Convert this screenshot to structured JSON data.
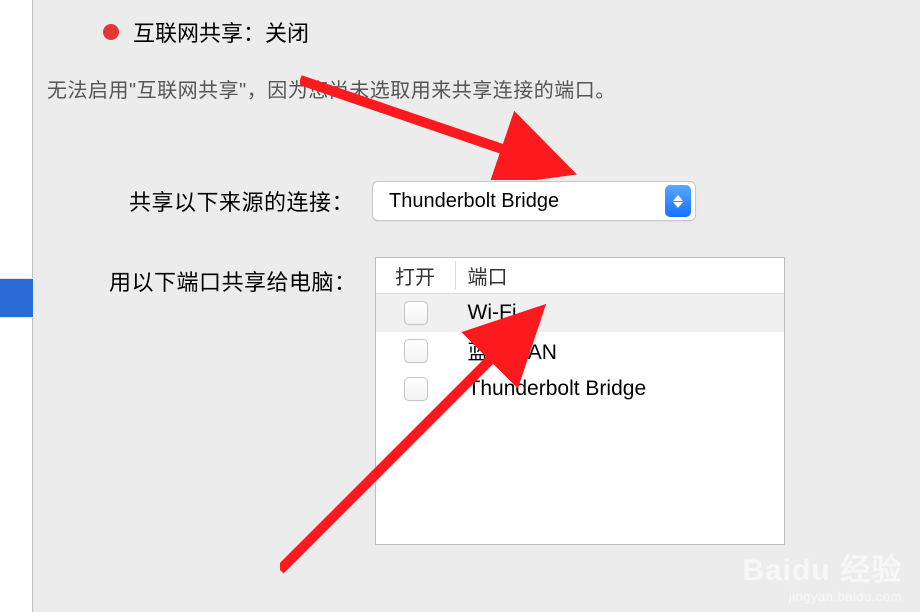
{
  "status": {
    "title": "互联网共享：关闭",
    "hint": "无法启用\"互联网共享\"，因为您尚未选取用来共享连接的端口。"
  },
  "source": {
    "label": "共享以下来源的连接：",
    "selected": "Thunderbolt Bridge"
  },
  "ports": {
    "label": "用以下端口共享给电脑：",
    "headers": {
      "open": "打开",
      "port": "端口"
    },
    "items": [
      {
        "name": "Wi-Fi",
        "checked": false,
        "selected": true
      },
      {
        "name": "蓝牙 PAN",
        "checked": false,
        "selected": false
      },
      {
        "name": "Thunderbolt Bridge",
        "checked": false,
        "selected": false
      }
    ]
  },
  "watermark": {
    "line1": "Baidu 经验",
    "line2": "jingyan.baidu.com"
  }
}
